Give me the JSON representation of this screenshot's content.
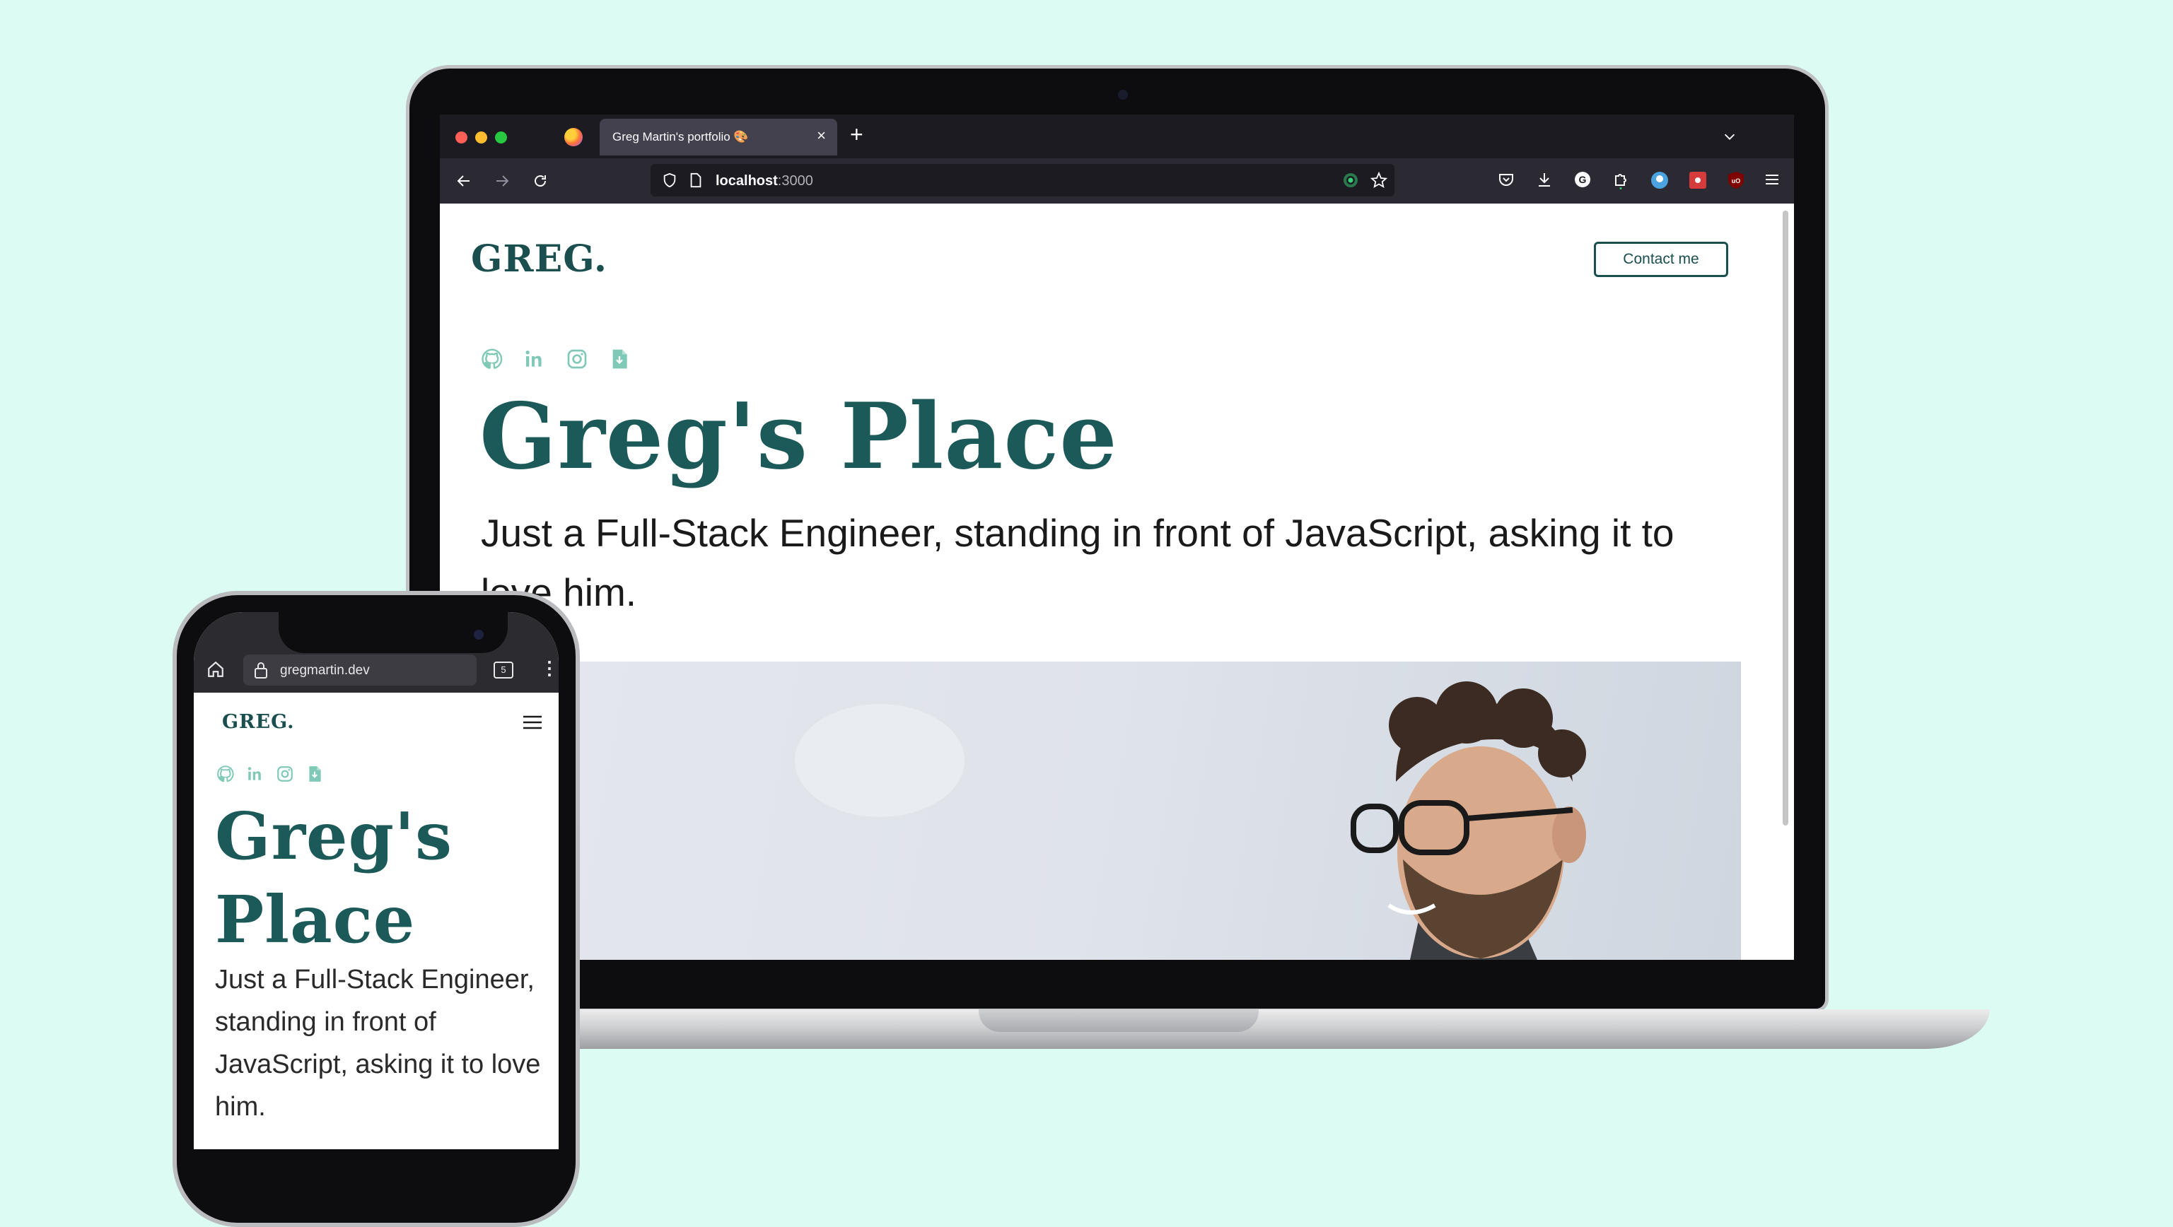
{
  "colors": {
    "background": "#dcfcf3",
    "brand": "#1b5a59",
    "social": "#7fc9b6",
    "browser_dark": "#1c1b22"
  },
  "desktop": {
    "tab": {
      "title": "Greg Martin's portfolio 🎨",
      "close": "×",
      "new_tab": "+"
    },
    "url": {
      "host": "localhost",
      "port": ":3000"
    },
    "icons": [
      "back-icon",
      "forward-icon",
      "reload-icon",
      "shield-icon",
      "page-icon",
      "extension-dot-icon",
      "bookmark-star-icon",
      "pocket-icon",
      "download-icon",
      "grammarly-icon",
      "extensions-icon",
      "account-icon",
      "react-devtools-icon",
      "ublock-icon",
      "menu-icon"
    ],
    "site": {
      "logo": "GREG.",
      "contact_button": "Contact me",
      "social_icons": [
        "github-icon",
        "linkedin-icon",
        "instagram-icon",
        "resume-icon"
      ],
      "title": "Greg's Place",
      "subtitle": "Just a Full-Stack Engineer, standing in front of JavaScript, asking it to love him."
    }
  },
  "mobile": {
    "url": "gregmartin.dev",
    "tab_count": "5",
    "kebab": "⋮",
    "site": {
      "logo": "GREG.",
      "social_icons": [
        "github-icon",
        "linkedin-icon",
        "instagram-icon",
        "resume-icon"
      ],
      "title_line1": "Greg's",
      "title_line2": "Place",
      "subtitle": "Just a Full-Stack Engineer, standing in front of JavaScript, asking it to love him."
    }
  }
}
